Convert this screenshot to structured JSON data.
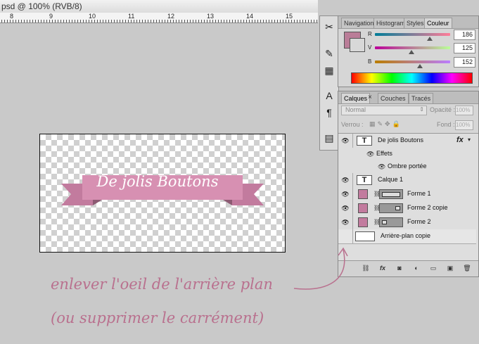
{
  "document": {
    "title": "psd @ 100% (RVB/8)",
    "ruler_labels": [
      "8",
      "9",
      "10",
      "11",
      "12",
      "13",
      "14",
      "15"
    ]
  },
  "canvas": {
    "banner_text": "De jolis Boutons",
    "banner_color": "#d790b2",
    "banner_tail_color": "#c27b9e"
  },
  "tools": {
    "icons": [
      "crossed-tools-icon",
      "wand-brush-icon",
      "stamp-icon",
      "text-tool-icon",
      "paragraph-icon",
      "notes-icon"
    ]
  },
  "color_panel": {
    "tabs": [
      "Navigation",
      "Histogram",
      "Styles",
      "Couleur"
    ],
    "active_tab": "Couleur",
    "channels": [
      {
        "label": "R",
        "value": "186",
        "level": 0.73
      },
      {
        "label": "V",
        "value": "125",
        "level": 0.49
      },
      {
        "label": "B",
        "value": "152",
        "level": 0.6
      }
    ],
    "foreground_color": "#ba7d98"
  },
  "layers_panel": {
    "tabs": [
      "Calques",
      "Couches",
      "Tracés"
    ],
    "active_tab": "Calques",
    "blend_mode": "Normal",
    "opacity_label": "Opacité :",
    "opacity_value": "100%",
    "lock_label": "Verrou :",
    "fill_label": "Fond :",
    "fill_value": "100%",
    "fx_label": "fx",
    "layers": [
      {
        "name": "De jolis Boutons",
        "kind": "text",
        "visible": true
      },
      {
        "name": "Effets",
        "kind": "effects",
        "visible": true
      },
      {
        "name": "Ombre portée",
        "kind": "effect",
        "visible": true
      },
      {
        "name": "Calque 1",
        "kind": "text",
        "visible": true
      },
      {
        "name": "Forme 1",
        "kind": "shape",
        "visible": true
      },
      {
        "name": "Forme 2 copie",
        "kind": "shape",
        "visible": true
      },
      {
        "name": "Forme 2",
        "kind": "shape",
        "visible": true
      },
      {
        "name": "Arrière-plan copie",
        "kind": "fill",
        "visible": false
      }
    ],
    "bottom_icons": [
      "link-icon",
      "fx-icon",
      "mask-icon",
      "adjustment-icon",
      "group-folder-icon",
      "new-layer-icon",
      "trash-icon"
    ]
  },
  "annotation": {
    "line1": "enlever l'oeil de l'arrière plan",
    "line2": "(ou supprimer le carrément)",
    "color": "#b9708e"
  }
}
